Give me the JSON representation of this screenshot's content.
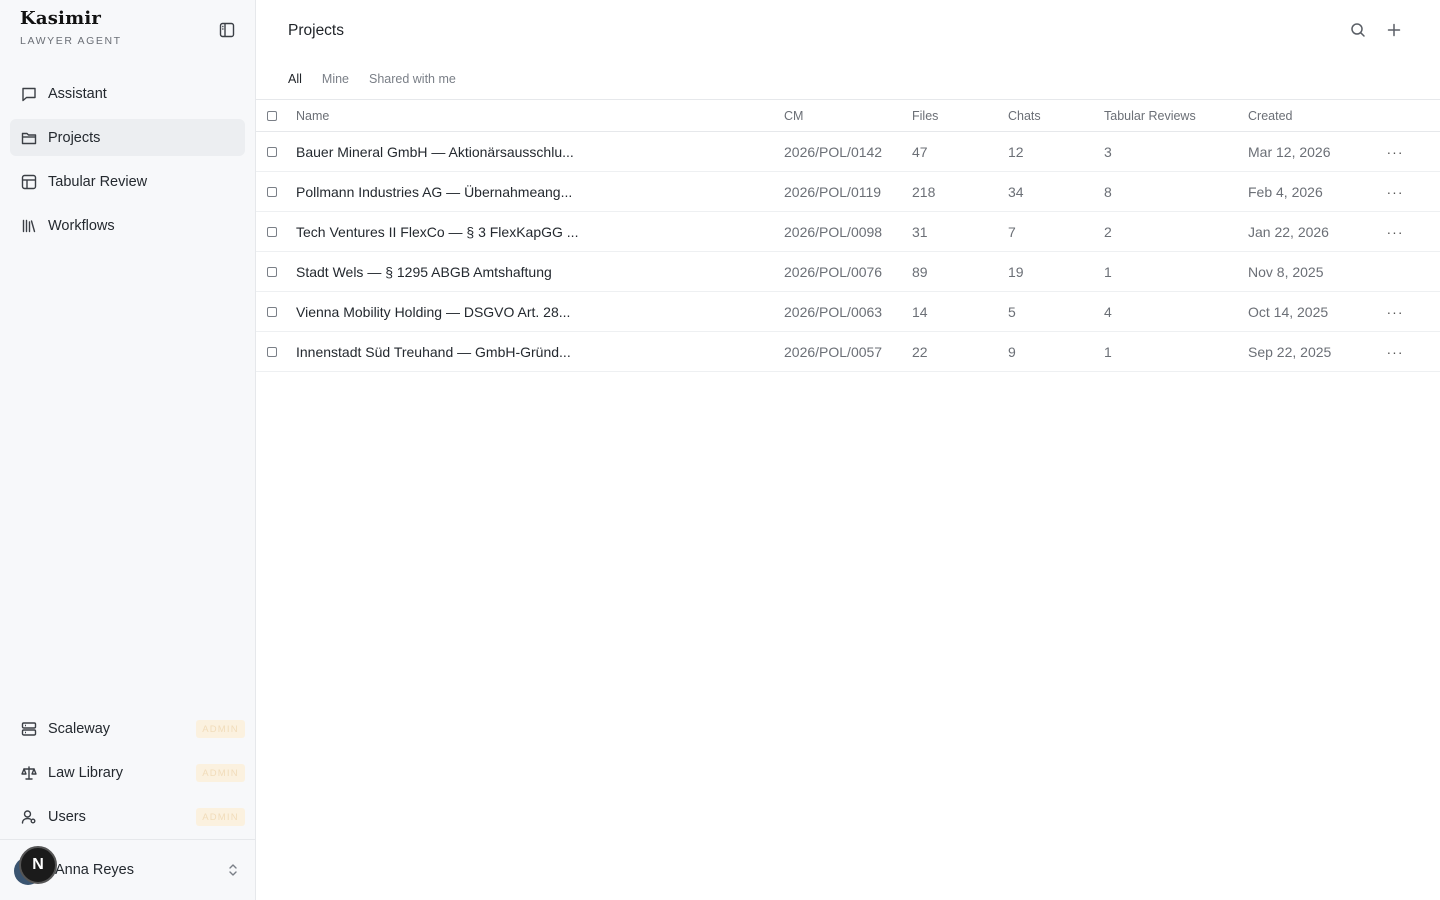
{
  "sidebar": {
    "brand": "Kasimir",
    "subtitle": "LAWYER AGENT",
    "items": [
      {
        "label": "Assistant",
        "icon": "chat-icon"
      },
      {
        "label": "Projects",
        "icon": "folder-icon",
        "active": true
      },
      {
        "label": "Tabular Review",
        "icon": "table-icon"
      },
      {
        "label": "Workflows",
        "icon": "library-icon"
      }
    ],
    "admin_items": [
      {
        "label": "Scaleway",
        "badge": "ADMIN",
        "icon": "server-icon"
      },
      {
        "label": "Law Library",
        "badge": "ADMIN",
        "icon": "scale-icon"
      },
      {
        "label": "Users",
        "badge": "ADMIN",
        "icon": "users-icon"
      }
    ],
    "user": {
      "name": "Anna Reyes",
      "avatar_initial": "N"
    }
  },
  "header": {
    "title": "Projects"
  },
  "tabs": [
    "All",
    "Mine",
    "Shared with me"
  ],
  "table": {
    "columns": [
      "Name",
      "CM",
      "Files",
      "Chats",
      "Tabular Reviews",
      "Created"
    ],
    "rows": [
      {
        "name": "Bauer Mineral GmbH — Aktionärsausschlu...",
        "cm": "2026/POL/0142",
        "files": "47",
        "chats": "12",
        "reviews": "3",
        "created": "Mar 12, 2026",
        "menu": true
      },
      {
        "name": "Pollmann Industries AG — Übernahmeang...",
        "cm": "2026/POL/0119",
        "files": "218",
        "chats": "34",
        "reviews": "8",
        "created": "Feb 4, 2026",
        "menu": true
      },
      {
        "name": "Tech Ventures II FlexCo — § 3 FlexKapGG ...",
        "cm": "2026/POL/0098",
        "files": "31",
        "chats": "7",
        "reviews": "2",
        "created": "Jan 22, 2026",
        "menu": true
      },
      {
        "name": "Stadt Wels — § 1295 ABGB Amtshaftung",
        "cm": "2026/POL/0076",
        "files": "89",
        "chats": "19",
        "reviews": "1",
        "created": "Nov 8, 2025",
        "menu": false
      },
      {
        "name": "Vienna Mobility Holding — DSGVO Art. 28...",
        "cm": "2026/POL/0063",
        "files": "14",
        "chats": "5",
        "reviews": "4",
        "created": "Oct 14, 2025",
        "menu": true
      },
      {
        "name": "Innenstadt Süd Treuhand — GmbH-Gründ...",
        "cm": "2026/POL/0057",
        "files": "22",
        "chats": "9",
        "reviews": "1",
        "created": "Sep 22, 2025",
        "menu": true
      }
    ]
  },
  "colors": {
    "sidebar_bg": "#f7f8fa",
    "active_item_bg": "#eceef1",
    "badge_bg": "#fbf1df"
  }
}
